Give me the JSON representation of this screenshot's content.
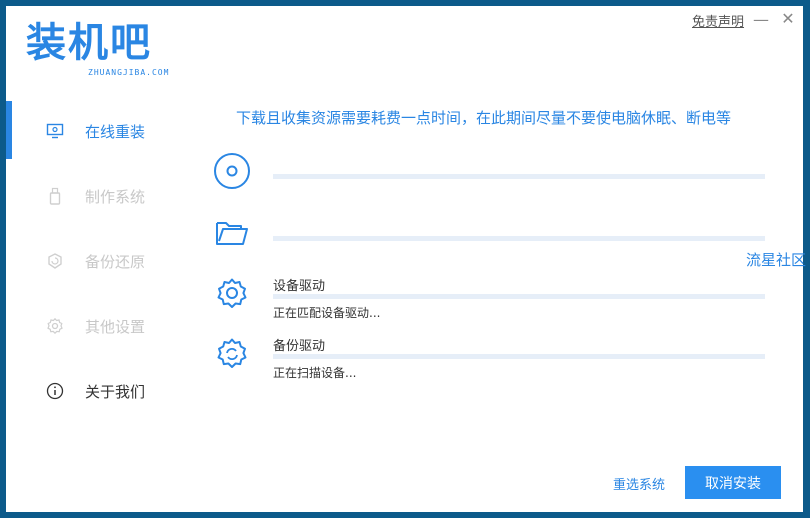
{
  "brand": {
    "logo_text": "装机吧",
    "logo_sub": "ZHUANGJIBA.COM",
    "accent": "#2a86e3"
  },
  "titlebar": {
    "disclaimer": "免责声明",
    "minimize": "—",
    "close": "✕"
  },
  "sidebar": {
    "items": [
      {
        "label": "在线重装",
        "icon": "monitor-icon",
        "active": true
      },
      {
        "label": "制作系统",
        "icon": "usb-icon"
      },
      {
        "label": "备份还原",
        "icon": "backup-icon"
      },
      {
        "label": "其他设置",
        "icon": "gear-icon"
      },
      {
        "label": "关于我们",
        "icon": "info-icon"
      }
    ]
  },
  "main": {
    "notice": "下载且收集资源需要耗费一点时间，在此期间尽量不要使电脑休眠、断电等",
    "steps": [
      {
        "icon": "disc-icon",
        "title": "",
        "status": "",
        "progress": 0
      },
      {
        "icon": "folder-icon",
        "title": "",
        "status": "",
        "progress": 0
      },
      {
        "icon": "gear-icon",
        "title": "设备驱动",
        "status": "正在匹配设备驱动...",
        "progress": 0
      },
      {
        "icon": "gear-refresh-icon",
        "title": "备份驱动",
        "status": "正在扫描设备...",
        "progress": 0
      }
    ]
  },
  "watermark": "流星社区",
  "footer": {
    "reselect": "重选系统",
    "cancel": "取消安装"
  }
}
